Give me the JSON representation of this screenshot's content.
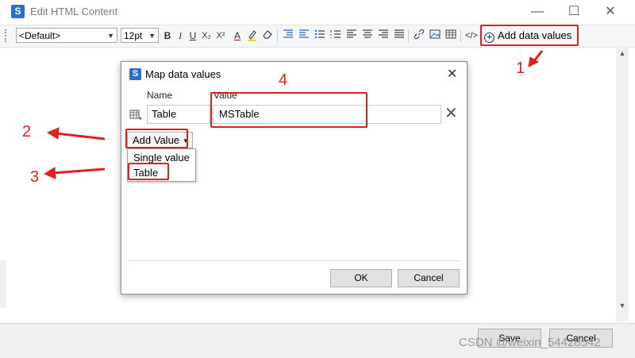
{
  "window": {
    "title": "Edit HTML Content",
    "app_icon": "S",
    "controls": [
      "—",
      "☐",
      "✕"
    ]
  },
  "toolbar": {
    "style_select": "<Default>",
    "size_select": "12pt",
    "add_data_values_label": "Add data values"
  },
  "bottom": {
    "save_label": "Save",
    "cancel_label": "Cancel",
    "watermark": "CSDN @weixin_54428542"
  },
  "dialog": {
    "title": "Map data values",
    "icon": "S",
    "columns": {
      "name": "Name",
      "value": "Value"
    },
    "row": {
      "name": "Table",
      "value": "MSTable"
    },
    "add_value_label": "Add Value",
    "menu_items": [
      "Single value",
      "Table"
    ],
    "ok_label": "OK",
    "cancel_label": "Cancel"
  },
  "annotations": {
    "n1": "1",
    "n2": "2",
    "n3": "3",
    "n4": "4",
    "color": "#e0201c"
  }
}
